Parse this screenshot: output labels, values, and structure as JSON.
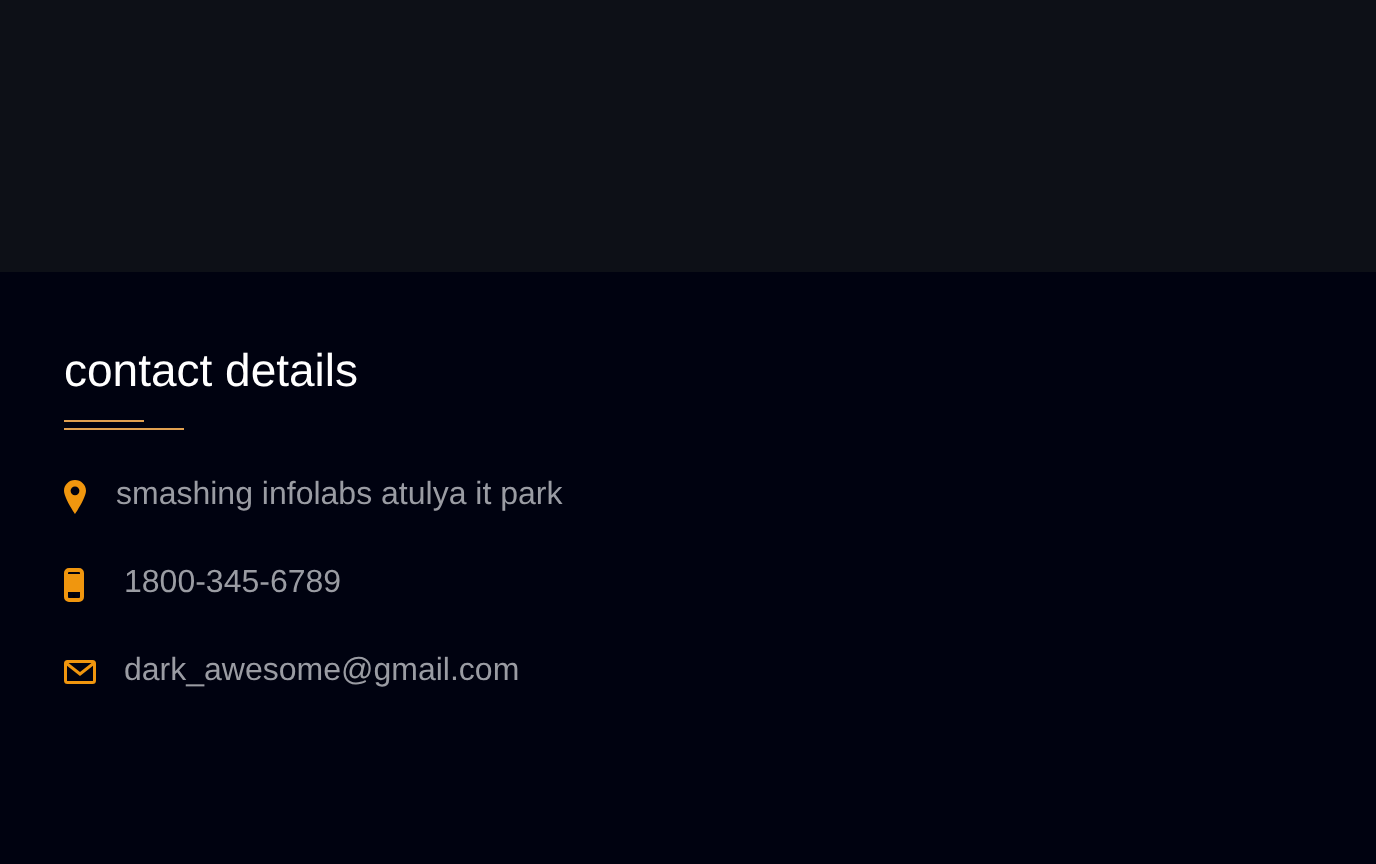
{
  "heading": "contact details",
  "items": [
    {
      "kind": "location",
      "text": "smashing infolabs atulya it park"
    },
    {
      "kind": "phone",
      "text": "1800-345-6789"
    },
    {
      "kind": "email",
      "text": "dark_awesome@gmail.com"
    }
  ]
}
